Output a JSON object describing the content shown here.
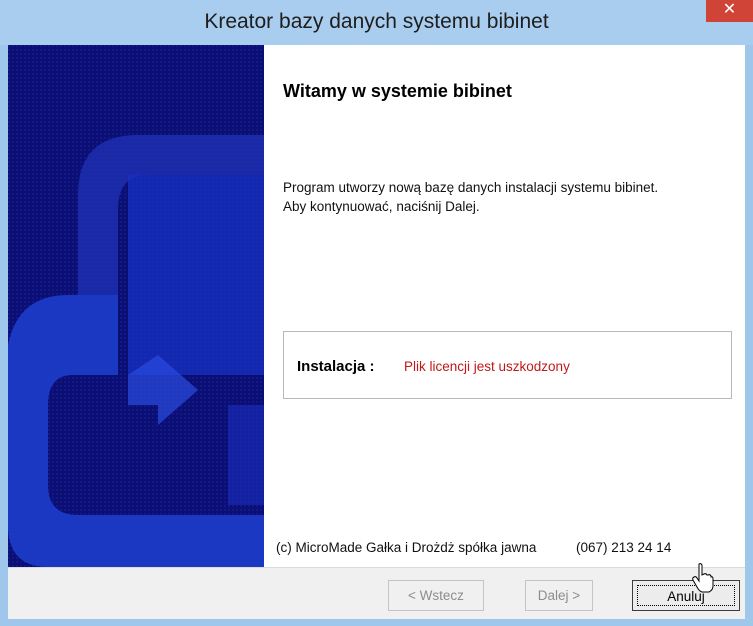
{
  "window": {
    "title": "Kreator bazy danych systemu bibinet",
    "close_glyph": "✕"
  },
  "content": {
    "heading": "Witamy w systemie bibinet",
    "intro_lines": [
      "Program utworzy nową bazę danych instalacji systemu bibinet.",
      "Aby kontynuować, naciśnij Dalej."
    ],
    "install": {
      "label": "Instalacja :",
      "value": "Plik licencji jest uszkodzony"
    },
    "footer": {
      "company": "(c) MicroMade Gałka i Drożdż spółka jawna",
      "phone": "(067) 213 24 14"
    }
  },
  "buttons": {
    "back": "< Wstecz",
    "next": "Dalej >",
    "cancel": "Anuluj"
  },
  "colors": {
    "banner": "#0b0e72",
    "error_text": "#c01818",
    "close_button": "#cf4436"
  },
  "icons": {
    "close": "close-icon",
    "cursor": "hand-pointer-cursor-icon",
    "banner": "wizard-banner-image"
  }
}
